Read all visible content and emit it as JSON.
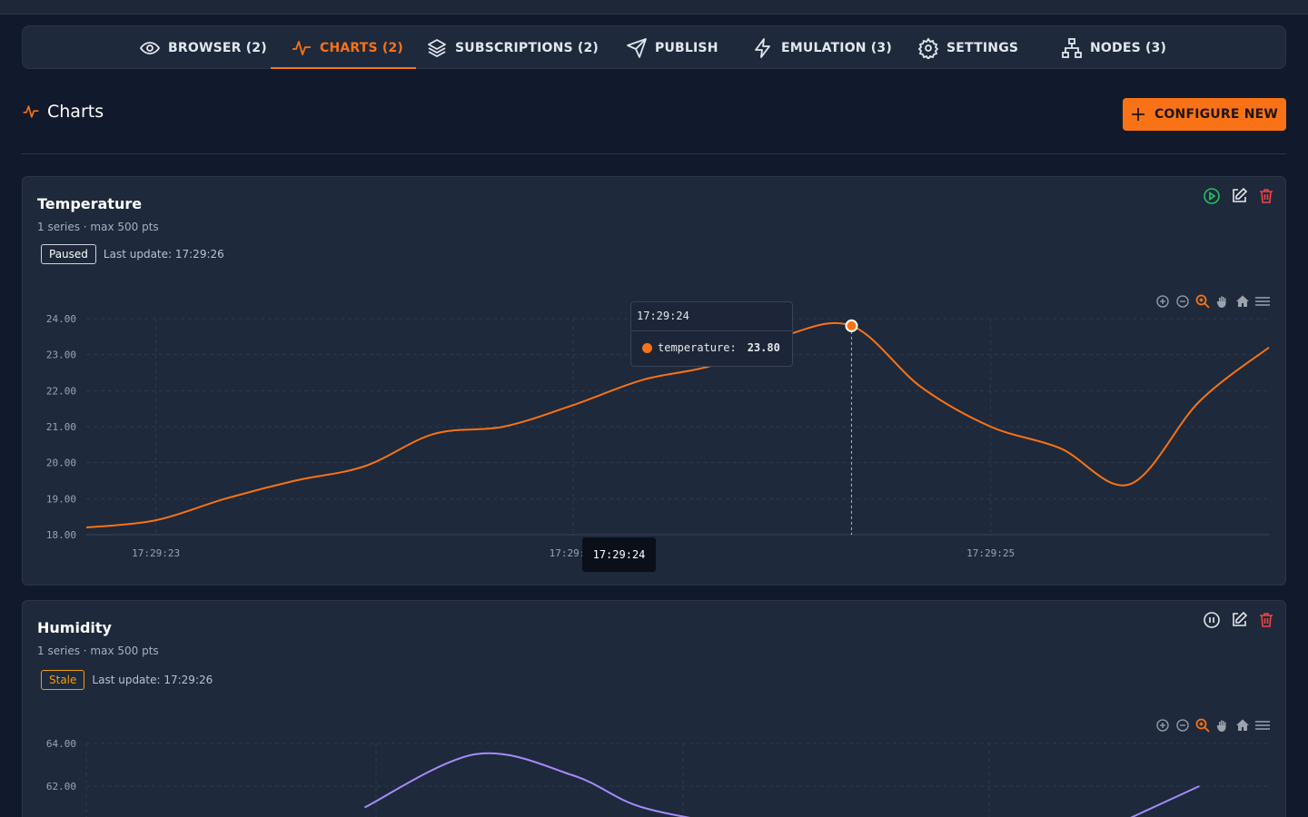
{
  "nav": {
    "tabs": [
      {
        "label": "BROWSER (2)",
        "icon": "eye-icon"
      },
      {
        "label": "CHARTS (2)",
        "icon": "activity-icon",
        "active": true
      },
      {
        "label": "SUBSCRIPTIONS (2)",
        "icon": "layers-icon"
      },
      {
        "label": "PUBLISH",
        "icon": "send-icon"
      },
      {
        "label": "EMULATION (3)",
        "icon": "bolt-icon"
      },
      {
        "label": "SETTINGS",
        "icon": "gear-icon"
      },
      {
        "label": "NODES (3)",
        "icon": "network-icon"
      }
    ]
  },
  "page": {
    "title": "Charts",
    "configure_label": "CONFIGURE NEW"
  },
  "colors": {
    "accent": "#f97316",
    "temperature_series": "#f97316",
    "humidity_series": "#a78bfa",
    "play": "#22c55e",
    "delete": "#ef4444",
    "stale": "#f59e0b"
  },
  "charts": [
    {
      "title": "Temperature",
      "subtitle": "1 series · max 500 pts",
      "status": "Paused",
      "last_update": "Last update: 17:29:26",
      "tooltip": {
        "time": "17:29:24",
        "series": "temperature:",
        "value": "23.80"
      },
      "crosshair_label": "17:29:24"
    },
    {
      "title": "Humidity",
      "subtitle": "1 series · max 500 pts",
      "status": "Stale",
      "last_update": "Last update: 17:29:26"
    }
  ],
  "chart_data": [
    {
      "type": "line",
      "series": [
        {
          "name": "temperature",
          "x": [
            0,
            0.5,
            1,
            1.5,
            2,
            2.5,
            3,
            3.5,
            4,
            4.5,
            5,
            5.5,
            6,
            6.5,
            7,
            7.5,
            8,
            8.5
          ],
          "y": [
            18.2,
            18.4,
            19.0,
            19.5,
            19.9,
            20.8,
            21.0,
            21.6,
            22.3,
            22.7,
            23.5,
            23.8,
            22.1,
            21.0,
            20.4,
            19.4,
            21.7,
            23.2
          ]
        }
      ],
      "x_ticks": [
        "17:29:23",
        "17:29:24",
        "17:29:25"
      ],
      "y_ticks": [
        "18.00",
        "19.00",
        "20.00",
        "21.00",
        "22.00",
        "23.00",
        "24.00"
      ],
      "ylim": [
        18,
        24
      ],
      "grid": true
    },
    {
      "type": "line",
      "series": [
        {
          "name": "humidity",
          "x": [
            2.0,
            2.8,
            3.5,
            4.0,
            4.8,
            7.5,
            8.0
          ],
          "y": [
            61.0,
            63.5,
            62.5,
            61.0,
            60.0,
            60.5,
            62.0
          ]
        }
      ],
      "y_ticks": [
        "62.00",
        "64.00"
      ],
      "grid": true
    }
  ]
}
